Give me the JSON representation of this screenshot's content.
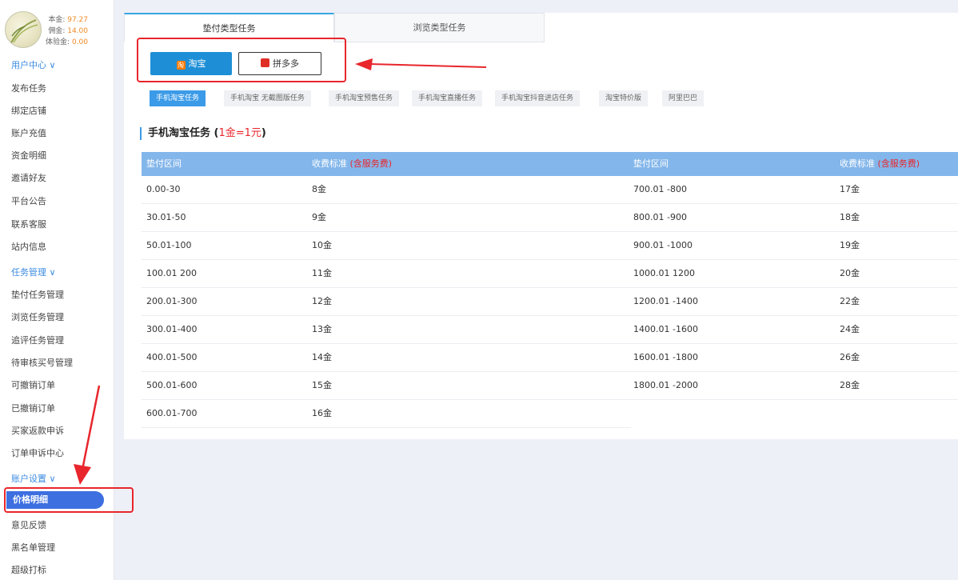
{
  "profile": {
    "principal_label": "本金:",
    "principal_value": "97.27",
    "commission_label": "佣金:",
    "commission_value": "14.00",
    "trial_label": "体验金:",
    "trial_value": "0.00"
  },
  "sidebar": {
    "section_user": "用户中心 ∨",
    "user_items": [
      "发布任务",
      "绑定店铺",
      "账户充值",
      "资金明细",
      "邀请好友",
      "平台公告",
      "联系客服",
      "站内信息"
    ],
    "section_task": "任务管理 ∨",
    "task_items": [
      "垫付任务管理",
      "浏览任务管理",
      "追评任务管理",
      "待审核买号管理",
      "可撤销订单",
      "已撤销订单",
      "买家返款申诉",
      "订单申诉中心"
    ],
    "section_account": "账户设置 ∨",
    "account_items": [
      "价格明细",
      "意见反馈",
      "黑名单管理",
      "超级打标"
    ],
    "active_item": "价格明细"
  },
  "tabs": [
    "垫付类型任务",
    "浏览类型任务"
  ],
  "platforms": {
    "taobao": "淘宝",
    "taobao_icon": "淘",
    "pdd": "拼多多"
  },
  "subtabs": [
    "手机淘宝任务",
    "手机淘宝 无截图版任务",
    "手机淘宝预售任务",
    "手机淘宝直播任务",
    "手机淘宝抖音进店任务",
    "淘宝特价版",
    "阿里巴巴"
  ],
  "section": {
    "title": "手机淘宝任务 (",
    "rate": "1金=1元",
    "close": ")"
  },
  "table": {
    "headers": {
      "range": "垫付区间",
      "fee": "收费标准",
      "fee_note": "(含服务费)"
    },
    "left_rows": [
      [
        "0.00-30",
        "8金"
      ],
      [
        "30.01-50",
        "9金"
      ],
      [
        "50.01-100",
        "10金"
      ],
      [
        "100.01 200",
        "11金"
      ],
      [
        "200.01-300",
        "12金"
      ],
      [
        "300.01-400",
        "13金"
      ],
      [
        "400.01-500",
        "14金"
      ],
      [
        "500.01-600",
        "15金"
      ],
      [
        "600.01-700",
        "16金"
      ]
    ],
    "right_rows": [
      [
        "700.01 -800",
        "17金"
      ],
      [
        "800.01 -900",
        "18金"
      ],
      [
        "900.01 -1000",
        "19金"
      ],
      [
        "1000.01  1200",
        "20金"
      ],
      [
        "1200.01 -1400",
        "22金"
      ],
      [
        "1400.01 -1600",
        "24金"
      ],
      [
        "1600.01 -1800",
        "26金"
      ],
      [
        "1800.01 -2000",
        "28金"
      ]
    ]
  },
  "colors": {
    "accent": "#3c9be8",
    "active_nav": "#3d6fe0",
    "table_header": "#83b6ea",
    "highlight_red": "#e8262c",
    "value_orange": "#f08a24"
  }
}
